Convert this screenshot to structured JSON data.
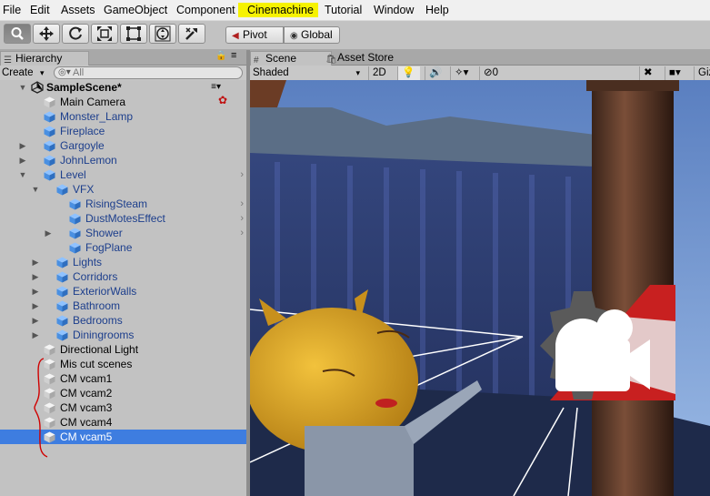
{
  "menu": [
    "File",
    "Edit",
    "Assets",
    "GameObject",
    "Component",
    "Cinemachine",
    "Tutorial",
    "Window",
    "Help"
  ],
  "menu_highlight": "Cinemachine",
  "toolbar": {
    "tools": [
      "hand-icon",
      "move-icon",
      "rotate-icon",
      "scale-icon",
      "rect-tool-icon",
      "transform-tool-icon",
      "custom-tool-icon"
    ],
    "pivot_label": "Pivot",
    "global_label": "Global"
  },
  "hierarchy": {
    "tab_label": "Hierarchy",
    "create_label": "Create",
    "search_placeholder": "All",
    "scene_name": "SampleScene*",
    "rows": [
      {
        "label": "Main Camera",
        "depth": 1,
        "arrow": "",
        "prefab": false,
        "chev": false,
        "selected": false
      },
      {
        "label": "Monster_Lamp",
        "depth": 1,
        "arrow": "",
        "prefab": true,
        "chev": false,
        "selected": false
      },
      {
        "label": "Fireplace",
        "depth": 1,
        "arrow": "",
        "prefab": true,
        "chev": false,
        "selected": false
      },
      {
        "label": "Gargoyle",
        "depth": 1,
        "arrow": "right",
        "prefab": true,
        "chev": false,
        "selected": false
      },
      {
        "label": "JohnLemon",
        "depth": 1,
        "arrow": "right",
        "prefab": true,
        "chev": false,
        "selected": false
      },
      {
        "label": "Level",
        "depth": 1,
        "arrow": "down",
        "prefab": true,
        "chev": true,
        "selected": false
      },
      {
        "label": "VFX",
        "depth": 2,
        "arrow": "down",
        "prefab": true,
        "chev": false,
        "selected": false
      },
      {
        "label": "RisingSteam",
        "depth": 3,
        "arrow": "",
        "prefab": true,
        "chev": true,
        "selected": false
      },
      {
        "label": "DustMotesEffect",
        "depth": 3,
        "arrow": "",
        "prefab": true,
        "chev": true,
        "selected": false
      },
      {
        "label": "Shower",
        "depth": 3,
        "arrow": "right",
        "prefab": true,
        "chev": true,
        "selected": false
      },
      {
        "label": "FogPlane",
        "depth": 3,
        "arrow": "",
        "prefab": true,
        "chev": false,
        "selected": false
      },
      {
        "label": "Lights",
        "depth": 2,
        "arrow": "right",
        "prefab": true,
        "chev": false,
        "selected": false
      },
      {
        "label": "Corridors",
        "depth": 2,
        "arrow": "right",
        "prefab": true,
        "chev": false,
        "selected": false
      },
      {
        "label": "ExteriorWalls",
        "depth": 2,
        "arrow": "right",
        "prefab": true,
        "chev": false,
        "selected": false
      },
      {
        "label": "Bathroom",
        "depth": 2,
        "arrow": "right",
        "prefab": true,
        "chev": false,
        "selected": false
      },
      {
        "label": "Bedrooms",
        "depth": 2,
        "arrow": "right",
        "prefab": true,
        "chev": false,
        "selected": false
      },
      {
        "label": "Diningrooms",
        "depth": 2,
        "arrow": "right",
        "prefab": true,
        "chev": false,
        "selected": false
      },
      {
        "label": "Directional Light",
        "depth": 1,
        "arrow": "",
        "prefab": false,
        "chev": false,
        "selected": false
      },
      {
        "label": "Mis cut scenes",
        "depth": 1,
        "arrow": "",
        "prefab": false,
        "chev": false,
        "selected": false
      },
      {
        "label": "CM vcam1",
        "depth": 1,
        "arrow": "",
        "prefab": false,
        "chev": false,
        "selected": false
      },
      {
        "label": "CM vcam2",
        "depth": 1,
        "arrow": "",
        "prefab": false,
        "chev": false,
        "selected": false
      },
      {
        "label": "CM vcam3",
        "depth": 1,
        "arrow": "",
        "prefab": false,
        "chev": false,
        "selected": false
      },
      {
        "label": "CM vcam4",
        "depth": 1,
        "arrow": "",
        "prefab": false,
        "chev": false,
        "selected": false
      },
      {
        "label": "CM vcam5",
        "depth": 1,
        "arrow": "",
        "prefab": false,
        "chev": false,
        "selected": true
      }
    ]
  },
  "scene": {
    "tab_scene": "Scene",
    "tab_asset_store": "Asset Store",
    "shading_mode": "Shaded",
    "mode_2d": "2D",
    "hidden_count": "0",
    "gizmos_label": "Giz"
  },
  "colors": {
    "selection": "#3e7de0",
    "prefab_text": "#1c3e8c",
    "menu_highlight": "#f6f200",
    "annotation": "#d00000"
  }
}
